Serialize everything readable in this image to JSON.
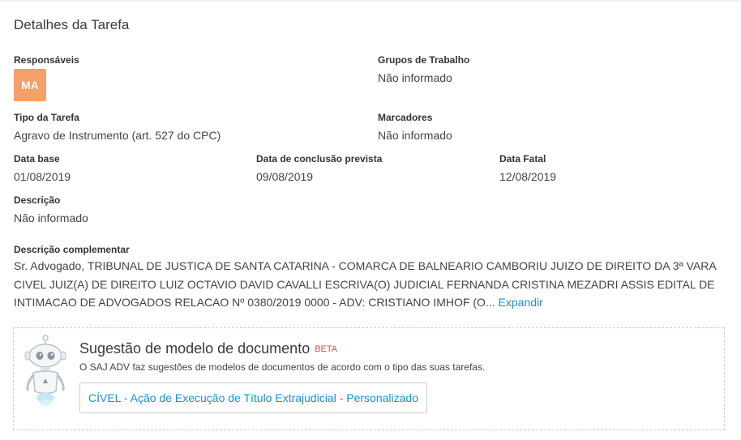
{
  "panel": {
    "title": "Detalhes da Tarefa"
  },
  "fields": {
    "responsaveis": {
      "label": "Responsáveis",
      "avatar_initials": "MA",
      "avatar_color": "#f4a068"
    },
    "grupos": {
      "label": "Grupos de Trabalho",
      "value": "Não informado"
    },
    "tipo": {
      "label": "Tipo da Tarefa",
      "value": "Agravo de Instrumento (art. 527 do CPC)"
    },
    "marcadores": {
      "label": "Marcadores",
      "value": "Não informado"
    },
    "data_base": {
      "label": "Data base",
      "value": "01/08/2019"
    },
    "data_conclusao": {
      "label": "Data de conclusão prevista",
      "value": "09/08/2019"
    },
    "data_fatal": {
      "label": "Data Fatal",
      "value": "12/08/2019"
    },
    "descricao": {
      "label": "Descrição",
      "value": "Não informado"
    },
    "descricao_complementar": {
      "label": "Descrição complementar",
      "value": "Sr. Advogado, TRIBUNAL DE JUSTICA DE SANTA CATARINA - COMARCA DE BALNEARIO CAMBORIU JUIZO DE DIREITO DA 3ª VARA CIVEL JUIZ(A) DE DIREITO LUIZ OCTAVIO DAVID CAVALLI ESCRIVA(O) JUDICIAL FERNANDA CRISTINA MEZADRI ASSIS EDITAL DE INTIMACAO DE ADVOGADOS RELACAO Nº 0380/2019 0000 - ADV: CRISTIANO IMHOF (O...",
      "expand_label": "Expandir"
    }
  },
  "suggestion": {
    "title": "Sugestão de modelo de documento",
    "badge": "BETA",
    "description": "O SAJ ADV faz sugestões de modelos de documentos de acordo com o tipo das suas tarefas.",
    "button_label": "CÍVEL - Ação de Execução de Título Extrajudicial - Personalizado",
    "robot_icon": "robot-icon"
  },
  "colors": {
    "link": "#1b8fd6",
    "beta": "#e04b3b",
    "avatar": "#f4a068"
  }
}
